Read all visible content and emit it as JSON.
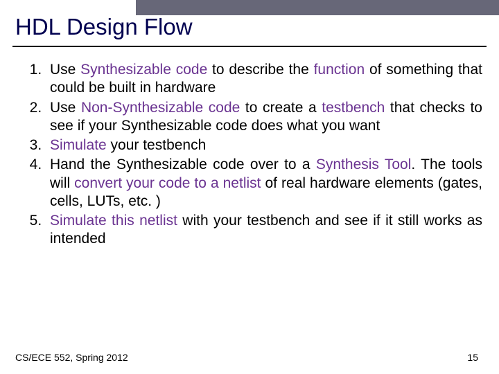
{
  "title": "HDL Design Flow",
  "items": [
    {
      "pre": "Use ",
      "em1": "Synthesizable code",
      "mid": " to describe the ",
      "em2": "function",
      "post": " of something that could be built in hardware"
    },
    {
      "pre": "Use ",
      "em1": "Non-Synthesizable code",
      "mid": " to create a ",
      "em2": "testbench",
      "post": " that checks to see if your Synthesizable code does what you want"
    },
    {
      "em1": "Simulate",
      "post": " your testbench"
    },
    {
      "pre": "Hand the Synthesizable code over to a ",
      "em1": "Synthesis Tool",
      "mid": ". The tools will ",
      "em2": "convert your code to a netlist",
      "post": " of real hardware elements (gates, cells, LUTs, etc. )"
    },
    {
      "em1": "Simulate this netlist",
      "post": " with your testbench and see if it still works as intended"
    }
  ],
  "footer": {
    "left": "CS/ECE 552, Spring 2012",
    "right": "15"
  }
}
